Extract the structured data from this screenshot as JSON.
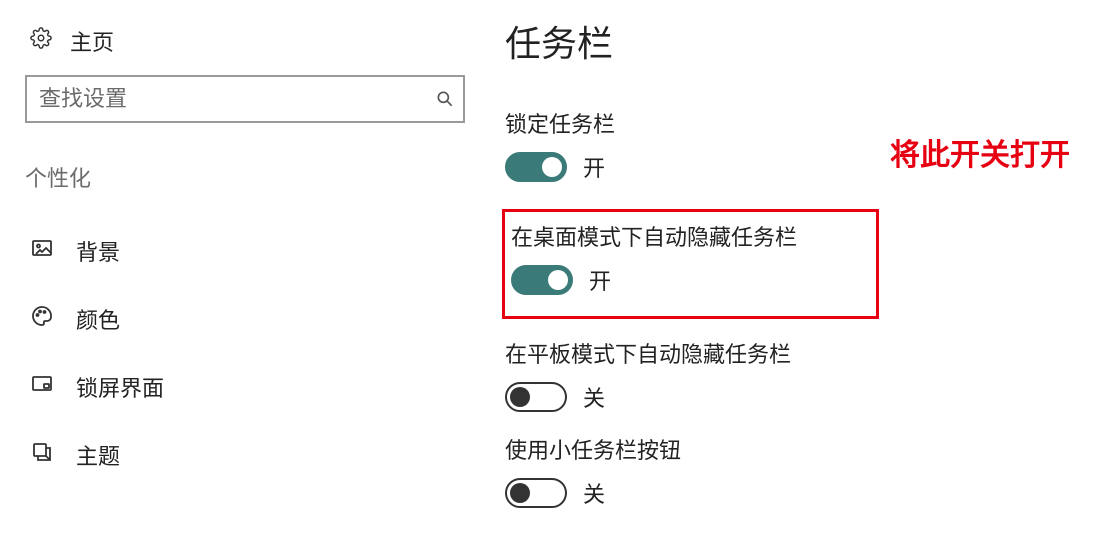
{
  "sidebar": {
    "home_label": "主页",
    "search_placeholder": "查找设置",
    "section_label": "个性化",
    "items": [
      {
        "label": "背景"
      },
      {
        "label": "颜色"
      },
      {
        "label": "锁屏界面"
      },
      {
        "label": "主题"
      }
    ]
  },
  "main": {
    "title": "任务栏",
    "annotation": "将此开关打开",
    "settings": [
      {
        "label": "锁定任务栏",
        "state": "on",
        "state_text": "开",
        "highlighted": false
      },
      {
        "label": "在桌面模式下自动隐藏任务栏",
        "state": "on",
        "state_text": "开",
        "highlighted": true
      },
      {
        "label": "在平板模式下自动隐藏任务栏",
        "state": "off",
        "state_text": "关",
        "highlighted": false
      },
      {
        "label": "使用小任务栏按钮",
        "state": "off",
        "state_text": "关",
        "highlighted": false
      }
    ]
  }
}
